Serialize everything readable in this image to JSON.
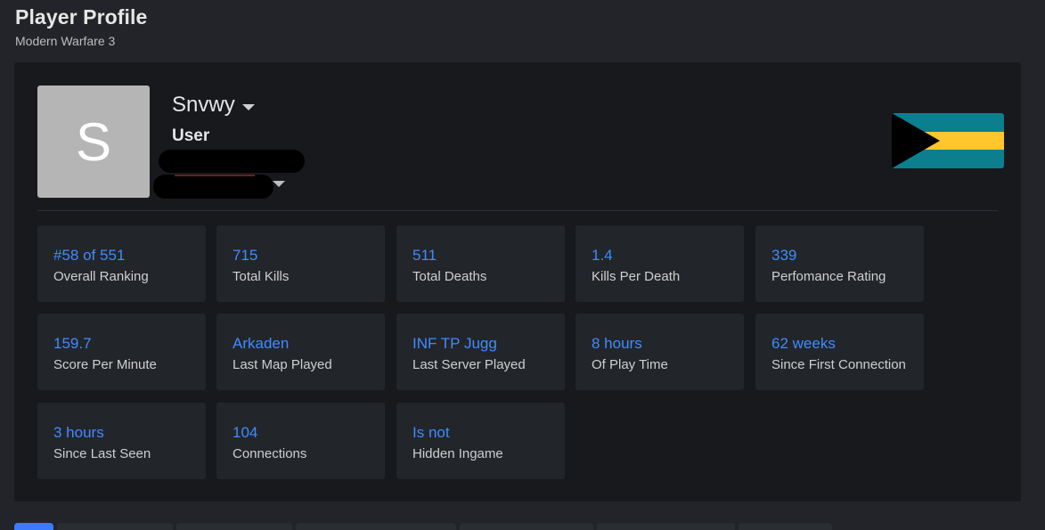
{
  "header": {
    "title": "Player Profile",
    "subtitle": "Modern Warfare 3"
  },
  "profile": {
    "avatar_letter": "S",
    "name": "Snvwy",
    "role": "User",
    "flag_icon": "bahamas-flag-icon"
  },
  "colors": {
    "accent": "#3f8cff",
    "flag_aquamarine": "#0b7f8e",
    "flag_gold": "#ffc72c",
    "flag_black": "#000000"
  },
  "stats": [
    {
      "value": "#58 of 551",
      "label": "Overall Ranking"
    },
    {
      "value": "715",
      "label": "Total Kills"
    },
    {
      "value": "511",
      "label": "Total Deaths"
    },
    {
      "value": "1.4",
      "label": "Kills Per Death"
    },
    {
      "value": "339",
      "label": "Perfomance Rating"
    },
    {
      "value": "159.7",
      "label": "Score Per Minute"
    },
    {
      "value": "Arkaden",
      "label": "Last Map Played"
    },
    {
      "value": "INF TP Jugg",
      "label": "Last Server Played"
    },
    {
      "value": "8 hours",
      "label": "Of Play Time"
    },
    {
      "value": "62 weeks",
      "label": "Since First Connection"
    },
    {
      "value": "3 hours",
      "label": "Since Last Seen"
    },
    {
      "value": "104",
      "label": "Connections"
    },
    {
      "value": "Is not",
      "label": "Hidden Ingame"
    }
  ]
}
